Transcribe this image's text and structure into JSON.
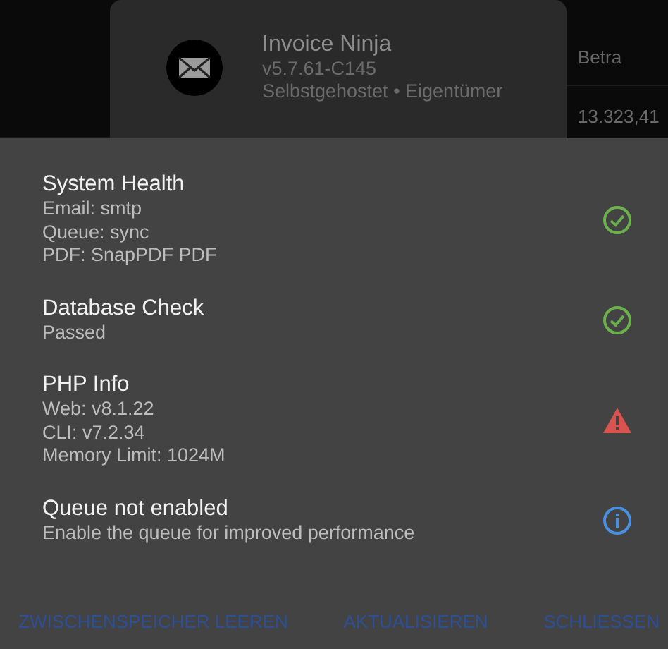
{
  "app_card": {
    "title": "Invoice Ninja",
    "version": "v5.7.61-C145",
    "subtitle": "Selbstgehostet • Eigentümer"
  },
  "background_table": {
    "header": "Betra",
    "cell": "13.323,41"
  },
  "health_checks": [
    {
      "title": "System Health",
      "details": [
        "Email: smtp",
        "Queue: sync",
        "PDF: SnapPDF PDF"
      ],
      "kind": "ok"
    },
    {
      "title": "Database Check",
      "details": [
        "Passed"
      ],
      "kind": "ok"
    },
    {
      "title": "PHP Info",
      "details": [
        "Web: v8.1.22",
        "CLI: v7.2.34",
        "Memory Limit: 1024M"
      ],
      "kind": "warning"
    },
    {
      "title": "Queue not enabled",
      "details": [
        "Enable the queue for improved performance"
      ],
      "kind": "info"
    }
  ],
  "buttons": [
    "ZWISCHENSPEICHER LEEREN",
    "AKTUALISIEREN",
    "SCHLIESSEN"
  ]
}
